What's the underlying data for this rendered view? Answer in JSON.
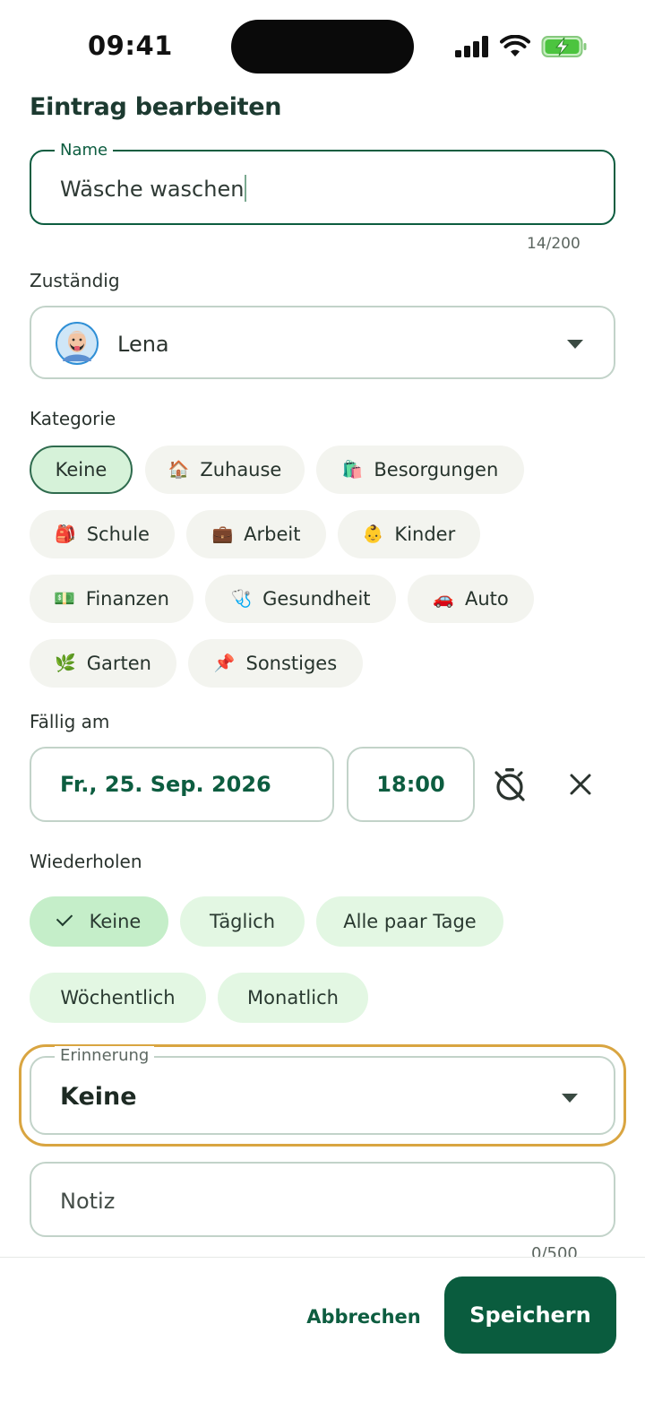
{
  "status_bar": {
    "time": "09:41"
  },
  "dialog": {
    "title": "Eintrag bearbeiten",
    "name_field": {
      "label": "Name",
      "value": "Wäsche waschen",
      "counter": "14/200"
    },
    "assignee": {
      "label": "Zuständig",
      "value": "Lena"
    },
    "category": {
      "label": "Kategorie",
      "chips": [
        {
          "emoji": "",
          "label": "Keine",
          "selected": true
        },
        {
          "emoji": "🏠",
          "label": "Zuhause"
        },
        {
          "emoji": "🛍️",
          "label": "Besorgungen"
        },
        {
          "emoji": "🎒",
          "label": "Schule"
        },
        {
          "emoji": "💼",
          "label": "Arbeit"
        },
        {
          "emoji": "👶",
          "label": "Kinder"
        },
        {
          "emoji": "💵",
          "label": "Finanzen"
        },
        {
          "emoji": "🩺",
          "label": "Gesundheit"
        },
        {
          "emoji": "🚗",
          "label": "Auto"
        },
        {
          "emoji": "🌿",
          "label": "Garten"
        },
        {
          "emoji": "📌",
          "label": "Sonstiges"
        }
      ]
    },
    "due": {
      "label": "Fällig am",
      "date": "Fr., 25. Sep. 2026",
      "time": "18:00"
    },
    "repeat": {
      "label": "Wiederholen",
      "options": [
        {
          "label": "Keine",
          "selected": true
        },
        {
          "label": "Täglich"
        },
        {
          "label": "Alle paar Tage"
        },
        {
          "label": "Wöchentlich"
        },
        {
          "label": "Monatlich"
        }
      ]
    },
    "reminder": {
      "label": "Erinnerung",
      "value": "Keine"
    },
    "note": {
      "placeholder": "Notiz",
      "counter": "0/500"
    },
    "actions": {
      "cancel": "Abbrechen",
      "save": "Speichern"
    }
  },
  "colors": {
    "primary": "#0a5c3e",
    "chip_selected": "#d6f2d9",
    "repeat_chip": "#e3f7e3",
    "highlight": "#d9a541"
  }
}
